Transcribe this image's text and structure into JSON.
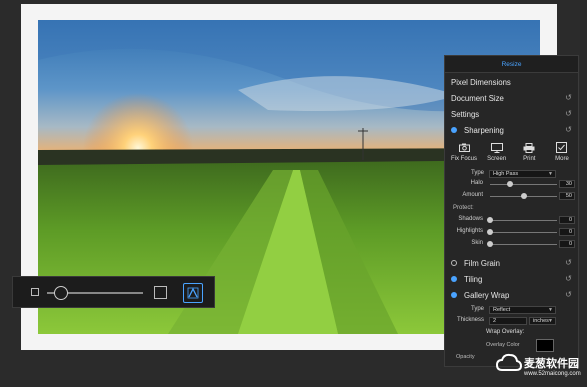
{
  "panel": {
    "header": "Resize",
    "sections": {
      "pixel_dimensions": "Pixel Dimensions",
      "document_size": "Document Size",
      "settings": "Settings",
      "sharpening": "Sharpening",
      "film_grain": "Film Grain",
      "tiling": "Tiling",
      "gallery_wrap": "Gallery Wrap"
    },
    "sharpen_tools": [
      "Fix Focus",
      "Screen",
      "Print",
      "More"
    ],
    "sharpening": {
      "type_label": "Type",
      "type_value": "High Pass",
      "halo_label": "Halo",
      "halo_value": "30",
      "halo_fraction": 0.3,
      "amount_label": "Amount",
      "amount_value": "50",
      "amount_fraction": 0.5,
      "protect_label": "Protect:",
      "shadows_label": "Shadows",
      "shadows_value": "0",
      "highlights_label": "Highlights",
      "highlights_value": "0",
      "skin_label": "Skin",
      "skin_value": "0"
    },
    "gallery_wrap": {
      "type_label": "Type",
      "type_value": "Reflect",
      "thickness_label": "Thickness",
      "thickness_value": "2",
      "thickness_unit": "inches",
      "overlay_label": "Wrap Overlay:",
      "overlay_color_label": "Overlay Color",
      "overlay_color": "#000000",
      "opacity_label": "Opacity"
    }
  },
  "zoom": {
    "level_fraction": 0.1
  },
  "watermark": {
    "name": "麦葱软件园",
    "url": "www.52maicong.com"
  },
  "colors": {
    "accent": "#4aa3ff",
    "panel_bg": "#262626",
    "app_bg": "#2b2b2b"
  },
  "icons": [
    "camera-icon",
    "monitor-icon",
    "printer-icon",
    "checkbox-icon",
    "reset-icon",
    "fit-to-screen-icon"
  ]
}
